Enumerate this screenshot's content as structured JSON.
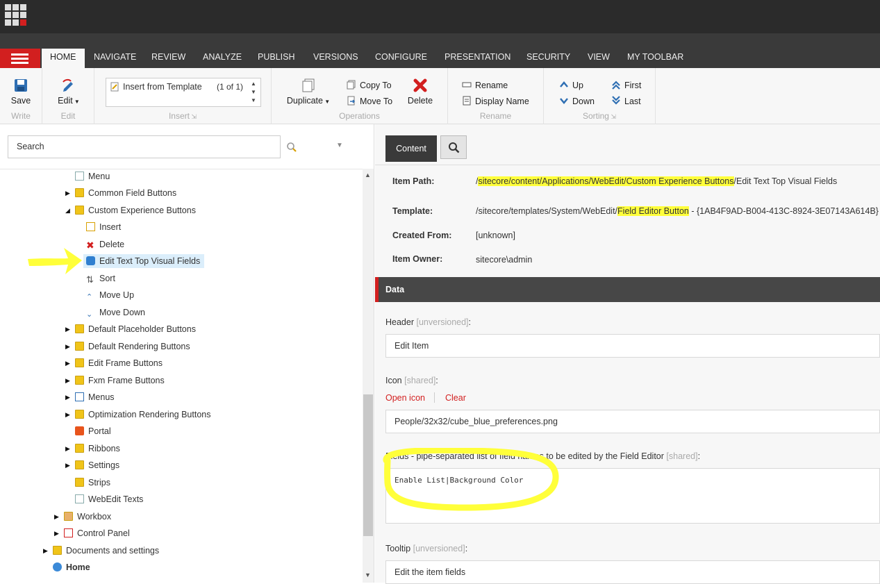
{
  "nav": {
    "tabs": [
      "HOME",
      "NAVIGATE",
      "REVIEW",
      "ANALYZE",
      "PUBLISH",
      "VERSIONS",
      "CONFIGURE",
      "PRESENTATION",
      "SECURITY",
      "VIEW",
      "MY TOOLBAR"
    ]
  },
  "ribbon": {
    "write": {
      "save_label": "Save",
      "group_label": "Write"
    },
    "edit": {
      "edit_label": "Edit",
      "group_label": "Edit"
    },
    "insert": {
      "gallery_item": "Insert from Template",
      "gallery_count": "(1 of 1)",
      "group_label": "Insert"
    },
    "operations": {
      "duplicate_label": "Duplicate",
      "copy_to_label": "Copy To",
      "move_to_label": "Move To",
      "delete_label": "Delete",
      "group_label": "Operations"
    },
    "rename": {
      "rename_label": "Rename",
      "display_name_label": "Display Name",
      "group_label": "Rename"
    },
    "sorting": {
      "up_label": "Up",
      "down_label": "Down",
      "first_label": "First",
      "last_label": "Last",
      "group_label": "Sorting"
    }
  },
  "search": {
    "placeholder": "Search"
  },
  "tree": {
    "items": [
      "Menu",
      "Common Field Buttons",
      "Custom Experience Buttons",
      "Insert",
      "Delete",
      "Edit Text Top Visual Fields",
      "Sort",
      "Move Up",
      "Move Down",
      "Default Placeholder Buttons",
      "Default Rendering Buttons",
      "Edit Frame Buttons",
      "Fxm Frame Buttons",
      "Menus",
      "Optimization Rendering Buttons",
      "Portal",
      "Ribbons",
      "Settings",
      "Strips",
      "WebEdit Texts",
      "Workbox",
      "Control Panel",
      "Documents and settings",
      "Home"
    ]
  },
  "editor": {
    "content_tab": "Content",
    "info": {
      "item_path_label": "Item Path:",
      "item_path_prefix": "/",
      "item_path_highlight": "sitecore/content/Applications/WebEdit/Custom Experience Buttons",
      "item_path_suffix": "/Edit Text Top Visual Fields",
      "template_label": "Template:",
      "template_prefix": "/sitecore/templates/System/WebEdit/",
      "template_highlight": "Field Editor Button",
      "template_suffix": " - {1AB4F9AD-B004-413C-8924-3E07143A614B}",
      "created_from_label": "Created From:",
      "created_from_value": "[unknown]",
      "item_owner_label": "Item Owner:",
      "item_owner_value": "sitecore\\admin"
    },
    "section_title": "Data",
    "fields": {
      "header_label": "Header",
      "header_meta": "[unversioned]",
      "header_value": "Edit Item",
      "icon_label": "Icon",
      "icon_meta": "[shared]",
      "open_icon_link": "Open icon",
      "clear_link": "Clear",
      "icon_value": "People/32x32/cube_blue_preferences.png",
      "fields_label": "Fields",
      "fields_desc": " - pipe-separated list of field names to be edited by the Field Editor",
      "fields_meta": "[shared]",
      "fields_value": "Enable List|Background Color",
      "tooltip_label": "Tooltip",
      "tooltip_meta": "[unversioned]",
      "tooltip_value": "Edit the item fields"
    }
  },
  "colors": {
    "accent": "#d21f1f",
    "highlight": "#ffff3a",
    "dark_bar": "#2b2b2b"
  }
}
